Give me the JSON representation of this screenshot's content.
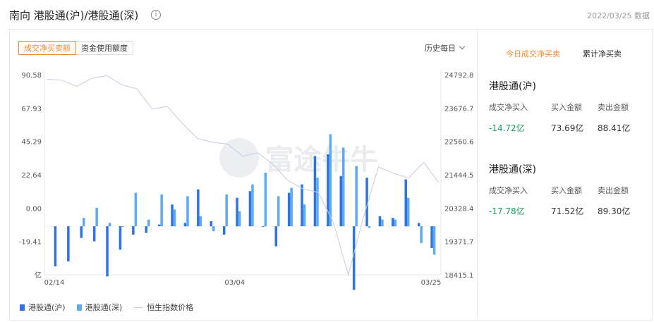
{
  "header": {
    "title": "南向 港股通(沪)/港股通(深)",
    "info_icon": "info-circle-icon",
    "date_text": "2022/03/25 数据"
  },
  "tabs": [
    {
      "label": "成交净买卖额",
      "active": true
    },
    {
      "label": "资金使用额度",
      "active": false
    }
  ],
  "period": {
    "label": "历史每日",
    "icon": "chevron-down-icon"
  },
  "legend": [
    {
      "label": "港股通(沪)",
      "color": "#2f73e0"
    },
    {
      "label": "港股通(深)",
      "color": "#5aabf2"
    },
    {
      "label": "恒生指数价格",
      "color": "#c5cbe0"
    }
  ],
  "colors": {
    "accent": "#f08a2e",
    "sh": "#2f73e0",
    "sz": "#5aabf2",
    "hsi": "#c5cbe0",
    "green": "#1aa35a"
  },
  "chart_data": {
    "type": "bar",
    "x_tick_labels": [
      "02/14",
      "03/04",
      "03/25"
    ],
    "left_axis": {
      "ticks": [
        "90.58",
        "67.93",
        "45.29",
        "22.64",
        "0.00",
        "-19.41",
        "亿"
      ],
      "ylim": [
        -29,
        90.58
      ]
    },
    "right_axis": {
      "ticks": [
        "24792.8",
        "23676.7",
        "22560.6",
        "21444.5",
        "20328.4",
        "19371.7",
        "18415.1"
      ],
      "ylim": [
        18415.1,
        24792.8
      ]
    },
    "series": [
      {
        "name": "港股通(沪)",
        "values": [
          -24,
          -21,
          -7,
          -9,
          -30,
          -14,
          -5,
          -4,
          1,
          13,
          2,
          22,
          3,
          -5,
          17,
          21,
          0,
          -12,
          20,
          25,
          42,
          43,
          30,
          -38,
          29,
          6,
          5,
          28,
          2,
          -13
        ]
      },
      {
        "name": "港股通(深)",
        "values": [
          5,
          11,
          2,
          0,
          20,
          4,
          19,
          10,
          18,
          6,
          -3,
          19,
          9,
          25,
          32,
          18,
          23,
          13,
          29,
          55,
          47,
          36,
          -1,
          4,
          4,
          17,
          -10,
          -17
        ]
      },
      {
        "name": "恒生指数价格",
        "values": [
          24650,
          24620,
          24420,
          24680,
          24760,
          24470,
          24340,
          23700,
          23780,
          23240,
          22760,
          22640,
          22580,
          22200,
          22300,
          21940,
          21420,
          21150,
          21050,
          20100,
          18420,
          20250,
          21850,
          21650,
          21500,
          22000,
          21350
        ]
      }
    ]
  },
  "side": {
    "tabs": [
      {
        "label": "今日成交净买卖",
        "active": true
      },
      {
        "label": "累计净买卖",
        "active": false
      }
    ],
    "blocks": [
      {
        "title": "港股通(沪)",
        "labels": [
          "成交净买入",
          "买入金额",
          "卖出金额"
        ],
        "values": [
          "-14.72亿",
          "73.69亿",
          "88.41亿"
        ]
      },
      {
        "title": "港股通(深)",
        "labels": [
          "成交净买入",
          "买入金额",
          "卖出金额"
        ],
        "values": [
          "-17.78亿",
          "71.52亿",
          "89.30亿"
        ]
      }
    ]
  }
}
